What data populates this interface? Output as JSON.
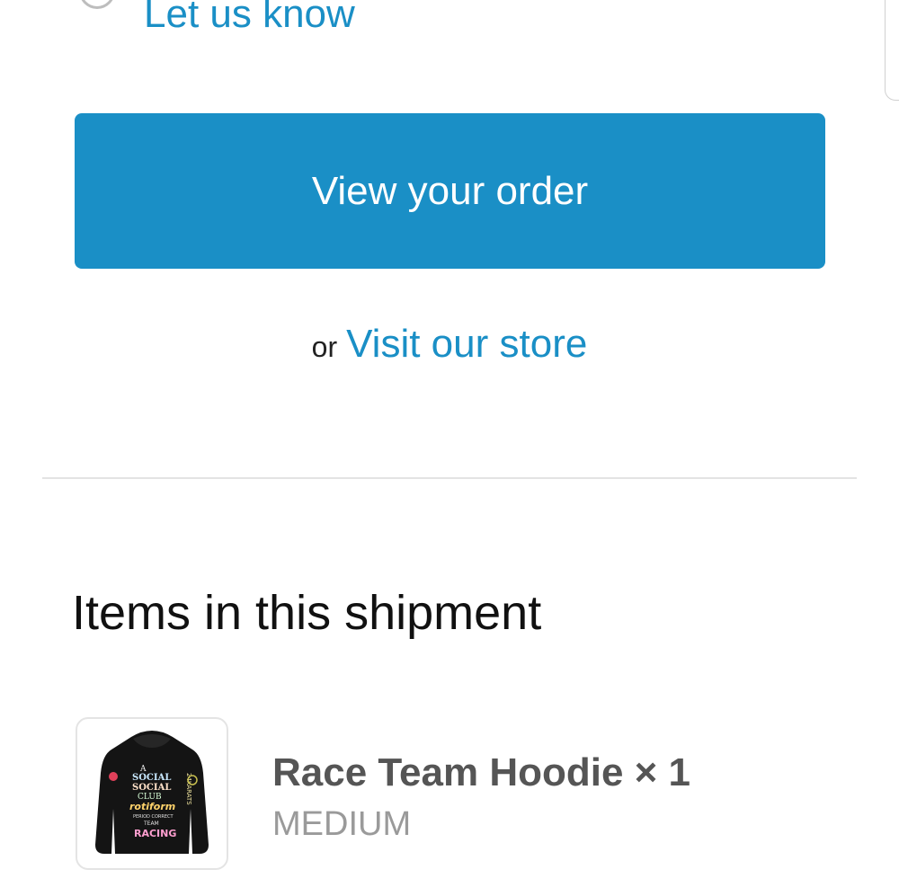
{
  "top": {
    "let_us_know_link": "Let us know"
  },
  "actions": {
    "view_order_label": "View your order",
    "or_text": "or",
    "visit_store_label": "Visit our store"
  },
  "shipment": {
    "section_title": "Items in this shipment",
    "items": [
      {
        "name_line": "Race Team Hoodie × 1",
        "variant": "MEDIUM",
        "thumbnail_text": [
          "A",
          "SOCIAL",
          "SOCIAL",
          "CLUB",
          "rotiform",
          "PERIOD CORRECT",
          "TEAM",
          "RACING",
          "24KARATS"
        ]
      }
    ]
  },
  "colors": {
    "accent": "#1a8fc6",
    "button_text": "#ffffff",
    "divider": "#e3e3e3",
    "item_name": "#555555",
    "item_variant": "#9a9a9a"
  }
}
